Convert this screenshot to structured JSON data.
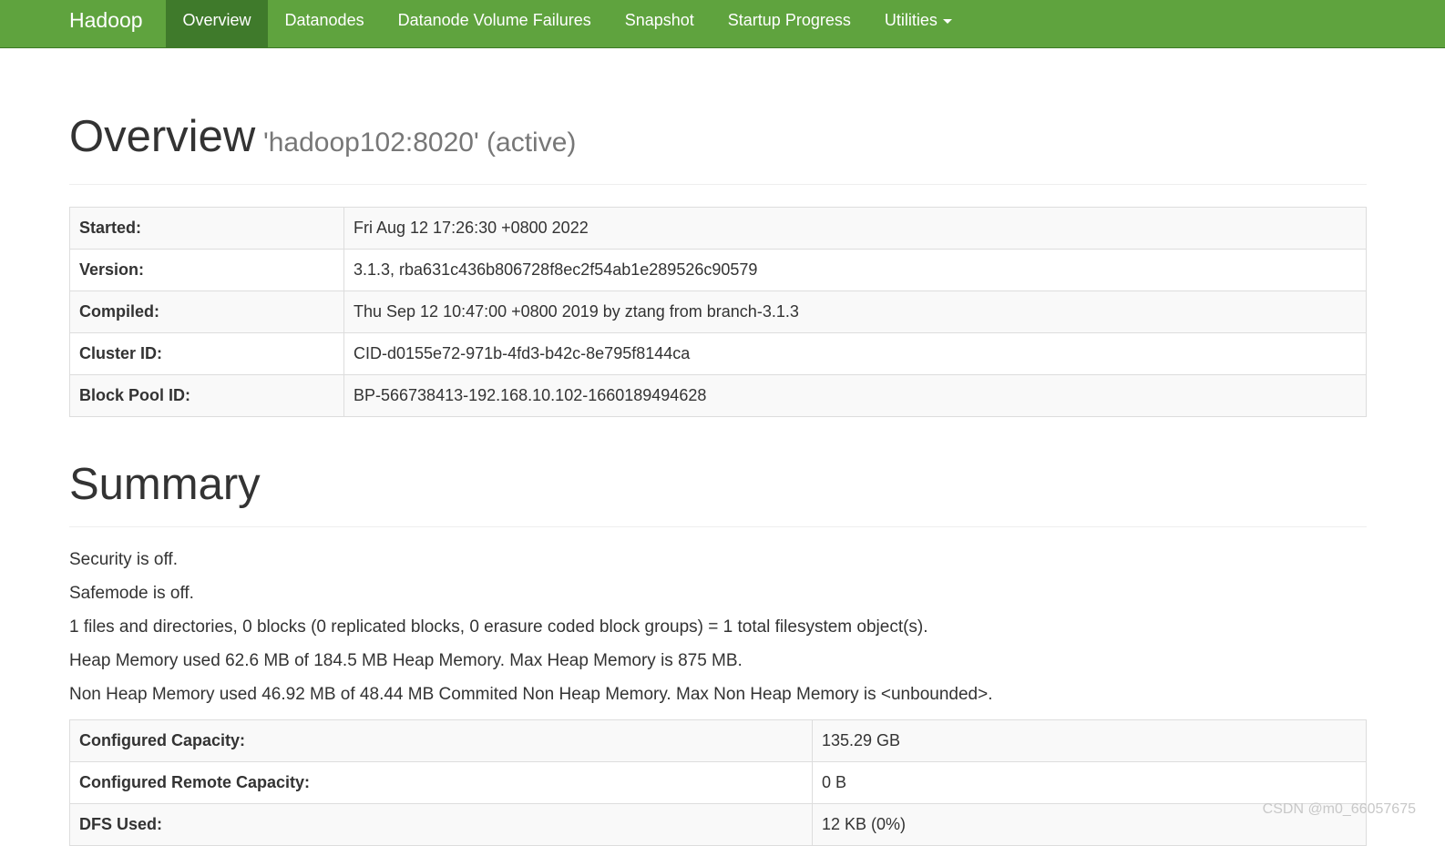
{
  "navbar": {
    "brand": "Hadoop",
    "items": [
      {
        "label": "Overview",
        "active": true
      },
      {
        "label": "Datanodes"
      },
      {
        "label": "Datanode Volume Failures"
      },
      {
        "label": "Snapshot"
      },
      {
        "label": "Startup Progress"
      },
      {
        "label": "Utilities"
      }
    ]
  },
  "header": {
    "title": "Overview",
    "subtitle": "'hadoop102:8020' (active)"
  },
  "overview": {
    "rows": [
      {
        "label": "Started:",
        "value": "Fri Aug 12 17:26:30 +0800 2022"
      },
      {
        "label": "Version:",
        "value": "3.1.3, rba631c436b806728f8ec2f54ab1e289526c90579"
      },
      {
        "label": "Compiled:",
        "value": "Thu Sep 12 10:47:00 +0800 2019 by ztang from branch-3.1.3"
      },
      {
        "label": "Cluster ID:",
        "value": "CID-d0155e72-971b-4fd3-b42c-8e795f8144ca"
      },
      {
        "label": "Block Pool ID:",
        "value": "BP-566738413-192.168.10.102-1660189494628"
      }
    ]
  },
  "summary": {
    "title": "Summary",
    "lines": [
      "Security is off.",
      "Safemode is off.",
      "1 files and directories, 0 blocks (0 replicated blocks, 0 erasure coded block groups) = 1 total filesystem object(s).",
      "Heap Memory used 62.6 MB of 184.5 MB Heap Memory. Max Heap Memory is 875 MB.",
      "Non Heap Memory used 46.92 MB of 48.44 MB Commited Non Heap Memory. Max Non Heap Memory is <unbounded>."
    ],
    "capacity_rows": [
      {
        "label": "Configured Capacity:",
        "value": "135.29 GB"
      },
      {
        "label": "Configured Remote Capacity:",
        "value": "0 B"
      },
      {
        "label": "DFS Used:",
        "value": "12 KB (0%)"
      }
    ]
  },
  "watermark": "CSDN @m0_66057675",
  "colors": {
    "navbar_bg": "#5fa33e",
    "navbar_active": "#3f7a2b",
    "text": "#333333",
    "muted": "#777777"
  },
  "icons": {
    "utilities_dropdown": "caret-down-icon"
  }
}
